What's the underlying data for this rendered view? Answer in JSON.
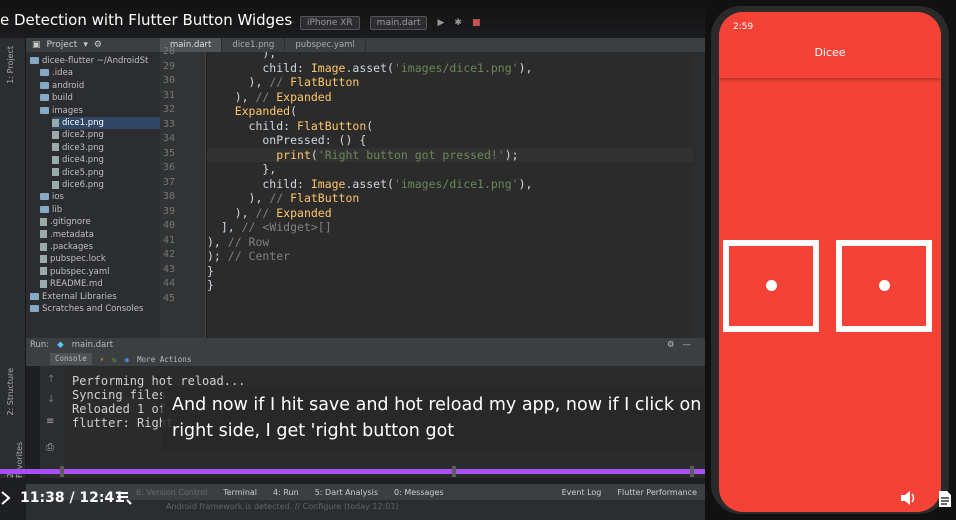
{
  "video": {
    "title": "e Detection with Flutter Button Widges",
    "time": "11:38 / 12:41",
    "progress": 0.915,
    "caption": "And now if I hit save and hot reload my app, now if I click on the\nright side, I get 'right button got"
  },
  "ide": {
    "toolbar": {
      "device": "iPhone XR",
      "run_config": "main.dart"
    },
    "project_header": "Project",
    "project_tree": [
      {
        "label": "dicee-flutter  ~/AndroidSt",
        "type": "folder"
      },
      {
        "label": ".idea",
        "type": "folder"
      },
      {
        "label": "android",
        "type": "folder"
      },
      {
        "label": "build",
        "type": "folder"
      },
      {
        "label": "images",
        "type": "folder"
      },
      {
        "label": "dice1.png",
        "type": "file"
      },
      {
        "label": "dice2.png",
        "type": "file"
      },
      {
        "label": "dice3.png",
        "type": "file"
      },
      {
        "label": "dice4.png",
        "type": "file"
      },
      {
        "label": "dice5.png",
        "type": "file"
      },
      {
        "label": "dice6.png",
        "type": "file"
      },
      {
        "label": "ios",
        "type": "folder"
      },
      {
        "label": "lib",
        "type": "folder"
      },
      {
        "label": ".gitignore",
        "type": "file"
      },
      {
        "label": ".metadata",
        "type": "file"
      },
      {
        "label": ".packages",
        "type": "file"
      },
      {
        "label": "pubspec.lock",
        "type": "file"
      },
      {
        "label": "pubspec.yaml",
        "type": "file"
      },
      {
        "label": "README.md",
        "type": "file"
      },
      {
        "label": "External Libraries",
        "type": "folder"
      },
      {
        "label": "Scratches and Consoles",
        "type": "folder"
      }
    ],
    "editor_tabs": [
      "main.dart",
      "dice1.png",
      "pubspec.yaml"
    ],
    "line_numbers": [
      "28",
      "29",
      "30",
      "31",
      "32",
      "33",
      "34",
      "35",
      "36",
      "37",
      "38",
      "39",
      "40",
      "41",
      "42",
      "43",
      "44",
      "45"
    ],
    "code_lines": [
      "        ),",
      "        child: Image.asset('images/dice1.png'),",
      "      ), // FlatButton",
      "    ), // Expanded",
      "    Expanded(",
      "      child: FlatButton(",
      "        onPressed: () {",
      "          print('Right button got pressed!');",
      "        },",
      "        child: Image.asset('images/dice1.png'),",
      "      ), // FlatButton",
      "    ), // Expanded",
      "  ], // <Widget>[]",
      "), // Row",
      "); // Center",
      "}",
      "}",
      ""
    ],
    "run_label": "Run:",
    "run_file": "main.dart",
    "console_tab": "Console",
    "more_actions": "More Actions",
    "console_lines": [
      "Performing hot reload...",
      "Syncing files",
      "Reloaded 1 of",
      "flutter: Right"
    ],
    "bottom_tabs": [
      "6: Version Control",
      "Terminal",
      "4: Run",
      "5: Dart Analysis",
      "0: Messages",
      "Event Log",
      "Flutter Performance"
    ],
    "status_text": "Android framework is detected. // Configure (today 12:01)",
    "left_tabs": [
      "1: Project",
      "2: Structure",
      "2: Favorites"
    ]
  },
  "phone": {
    "status_time": "2:59",
    "app_title": "Dicee"
  },
  "colors": {
    "accent_progress": "#a94ef5",
    "app_red": "#f44336"
  }
}
